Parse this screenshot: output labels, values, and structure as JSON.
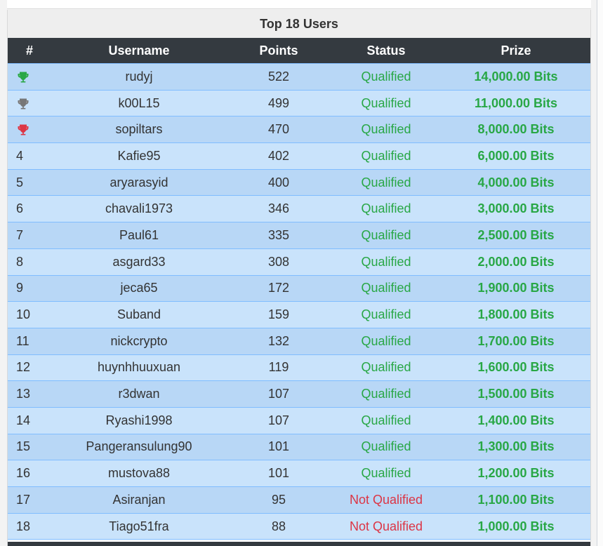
{
  "panel": {
    "title": "Top 18 Users"
  },
  "table": {
    "headers": [
      "#",
      "Username",
      "Points",
      "Status",
      "Prize"
    ],
    "rows": [
      {
        "rank": "",
        "rank_icon": "trophy-icon-gold",
        "icon_color": "#28a745",
        "username": "rudyj",
        "points": "522",
        "status": "Qualified",
        "qualified": true,
        "prize": "14,000.00 Bits"
      },
      {
        "rank": "",
        "rank_icon": "trophy-icon-silver",
        "icon_color": "#777777",
        "username": "k00L15",
        "points": "499",
        "status": "Qualified",
        "qualified": true,
        "prize": "11,000.00 Bits"
      },
      {
        "rank": "",
        "rank_icon": "trophy-icon-bronze",
        "icon_color": "#dc3545",
        "username": "sopiltars",
        "points": "470",
        "status": "Qualified",
        "qualified": true,
        "prize": "8,000.00 Bits"
      },
      {
        "rank": "4",
        "username": "Kafie95",
        "points": "402",
        "status": "Qualified",
        "qualified": true,
        "prize": "6,000.00 Bits"
      },
      {
        "rank": "5",
        "username": "aryarasyid",
        "points": "400",
        "status": "Qualified",
        "qualified": true,
        "prize": "4,000.00 Bits"
      },
      {
        "rank": "6",
        "username": "chavali1973",
        "points": "346",
        "status": "Qualified",
        "qualified": true,
        "prize": "3,000.00 Bits"
      },
      {
        "rank": "7",
        "username": "Paul61",
        "points": "335",
        "status": "Qualified",
        "qualified": true,
        "prize": "2,500.00 Bits"
      },
      {
        "rank": "8",
        "username": "asgard33",
        "points": "308",
        "status": "Qualified",
        "qualified": true,
        "prize": "2,000.00 Bits"
      },
      {
        "rank": "9",
        "username": "jeca65",
        "points": "172",
        "status": "Qualified",
        "qualified": true,
        "prize": "1,900.00 Bits"
      },
      {
        "rank": "10",
        "username": "Suband",
        "points": "159",
        "status": "Qualified",
        "qualified": true,
        "prize": "1,800.00 Bits"
      },
      {
        "rank": "11",
        "username": "nickcrypto",
        "points": "132",
        "status": "Qualified",
        "qualified": true,
        "prize": "1,700.00 Bits"
      },
      {
        "rank": "12",
        "username": "huynhhuuxuan",
        "points": "119",
        "status": "Qualified",
        "qualified": true,
        "prize": "1,600.00 Bits"
      },
      {
        "rank": "13",
        "username": "r3dwan",
        "points": "107",
        "status": "Qualified",
        "qualified": true,
        "prize": "1,500.00 Bits"
      },
      {
        "rank": "14",
        "username": "Ryashi1998",
        "points": "107",
        "status": "Qualified",
        "qualified": true,
        "prize": "1,400.00 Bits"
      },
      {
        "rank": "15",
        "username": "Pangeransulung90",
        "points": "101",
        "status": "Qualified",
        "qualified": true,
        "prize": "1,300.00 Bits"
      },
      {
        "rank": "16",
        "username": "mustova88",
        "points": "101",
        "status": "Qualified",
        "qualified": true,
        "prize": "1,200.00 Bits"
      },
      {
        "rank": "17",
        "username": "Asiranjan",
        "points": "95",
        "status": "Not Qualified",
        "qualified": false,
        "prize": "1,100.00 Bits"
      },
      {
        "rank": "18",
        "username": "Tiago51fra",
        "points": "88",
        "status": "Not Qualified",
        "qualified": false,
        "prize": "1,000.00 Bits"
      }
    ]
  },
  "colors": {
    "header_bg": "#343a40",
    "row_odd": "#b8d7f6",
    "row_even": "#c9e3fb",
    "qualified": "#28a745",
    "not_qualified": "#dc3545",
    "prize": "#28a745"
  }
}
